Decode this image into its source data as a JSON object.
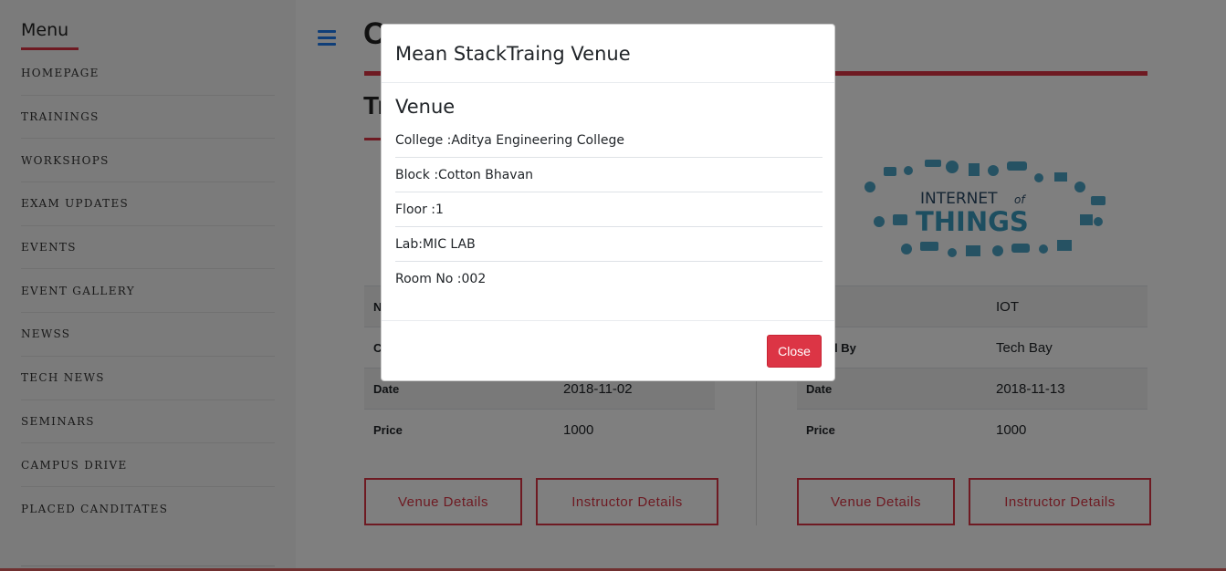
{
  "sidebar": {
    "title": "Menu",
    "items": [
      {
        "label": "HOMEPAGE"
      },
      {
        "label": "TRAININGS"
      },
      {
        "label": "WORKSHOPS"
      },
      {
        "label": "EXAM UPDATES"
      },
      {
        "label": "EVENTS"
      },
      {
        "label": "EVENT GALLERY"
      },
      {
        "label": "NEWSS"
      },
      {
        "label": "TECH NEWS"
      },
      {
        "label": "SEMINARS"
      },
      {
        "label": "CAMPUS DRIVE"
      },
      {
        "label": "PLACED CANDITATES"
      }
    ]
  },
  "main": {
    "title_partial": "O",
    "section_partial": "Tr",
    "cards": [
      {
        "rows": [
          {
            "key": "N",
            "value": ""
          },
          {
            "key": "C",
            "value": ""
          },
          {
            "key": "Date",
            "value": "2018-11-02"
          },
          {
            "key": "Price",
            "value": "1000"
          }
        ],
        "venue_button": "Venue Details",
        "instructor_button": "Instructor Details"
      },
      {
        "image_text_top": "INTERNET",
        "image_text_of": "of",
        "image_text_bottom": "THINGS",
        "rows": [
          {
            "key": "e",
            "value": "IOT"
          },
          {
            "key": "ucted By",
            "value": "Tech Bay"
          },
          {
            "key": "Date",
            "value": "2018-11-13"
          },
          {
            "key": "Price",
            "value": "1000"
          }
        ],
        "venue_button": "Venue Details",
        "instructor_button": "Instructor Details"
      }
    ]
  },
  "modal": {
    "title": "Mean StackTraing Venue",
    "heading": "Venue",
    "rows": [
      {
        "text": "College :Aditya Engineering College"
      },
      {
        "text": "Block :Cotton Bhavan"
      },
      {
        "text": "Floor :1"
      },
      {
        "text": "Lab:MIC LAB"
      },
      {
        "text": "Room No :002"
      }
    ],
    "close_label": "Close"
  },
  "colors": {
    "accent": "#dc3545",
    "hamburger": "#1e7cf0",
    "iot_blue": "#3a9cc0",
    "iot_dark": "#2b4a66"
  }
}
